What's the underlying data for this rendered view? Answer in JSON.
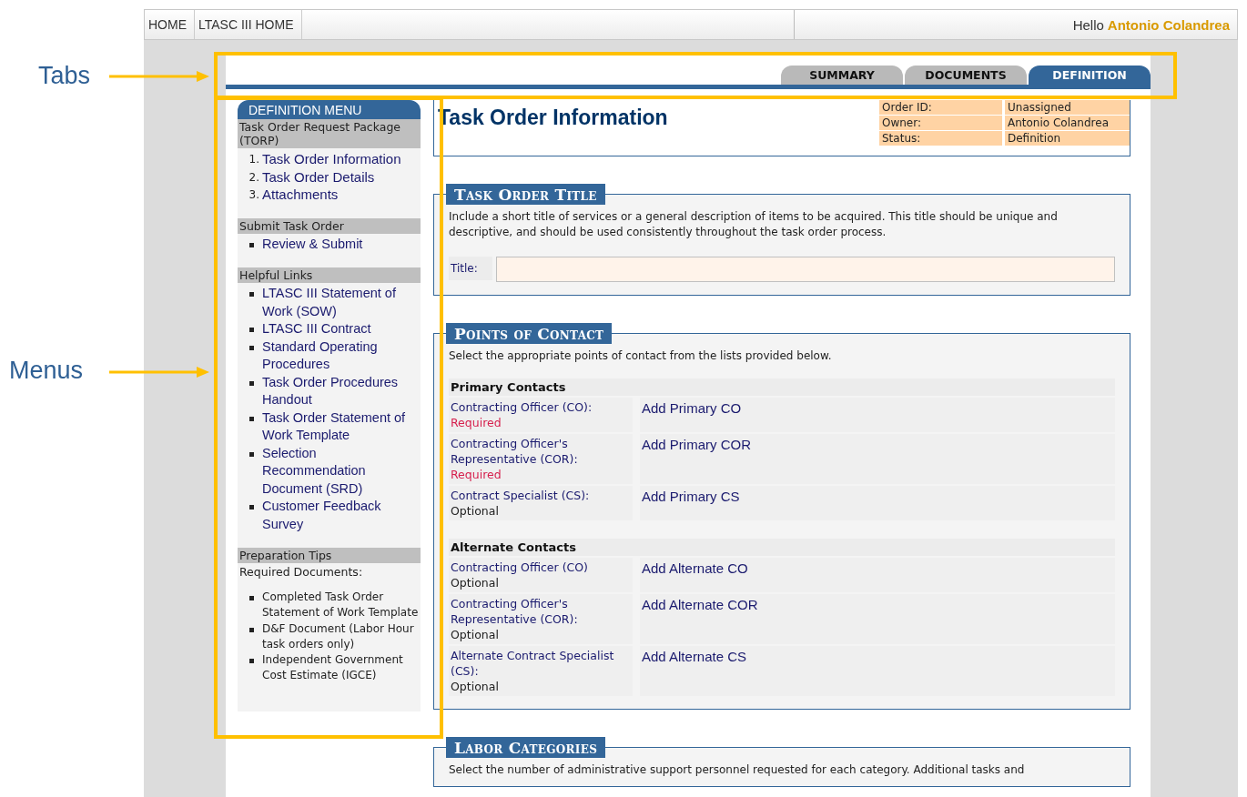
{
  "nav": {
    "links": [
      "HOME",
      "LTASC III HOME"
    ],
    "greeting": "Hello",
    "user": "Antonio Colandrea"
  },
  "tabs": [
    {
      "label": "SUMMARY",
      "selected": false
    },
    {
      "label": "DOCUMENTS",
      "selected": false
    },
    {
      "label": "DEFINITION",
      "selected": true
    }
  ],
  "sidebar": {
    "title": "DEFINITION MENU",
    "sections": [
      {
        "heading": "Task Order Request Package (TORP)",
        "kind": "ordered",
        "items": [
          {
            "label": "Task Order Information",
            "marker": "1."
          },
          {
            "label": "Task Order Details",
            "marker": "2."
          },
          {
            "label": "Attachments",
            "marker": "3."
          }
        ]
      },
      {
        "heading": "Submit Task Order",
        "kind": "links",
        "items": [
          {
            "label": "Review & Submit"
          }
        ]
      },
      {
        "heading": "Helpful Links",
        "kind": "links",
        "items": [
          {
            "label": "LTASC III Statement of Work (SOW)"
          },
          {
            "label": "LTASC III Contract"
          },
          {
            "label": "Standard Operating Procedures"
          },
          {
            "label": "Task Order Procedures Handout"
          },
          {
            "label": "Task Order Statement of Work Template"
          },
          {
            "label": "Selection Recommendation Document (SRD)"
          },
          {
            "label": "Customer Feedback Survey"
          }
        ]
      },
      {
        "heading": "Preparation Tips",
        "kind": "tips",
        "intro": "Required Documents:",
        "items": [
          {
            "label": "Completed Task Order Statement of Work Template"
          },
          {
            "label": "D&F Document (Labor Hour task orders only)"
          },
          {
            "label": "Independent Government Cost Estimate (IGCE)"
          }
        ]
      }
    ]
  },
  "page_title": "Task Order Information",
  "order_info": [
    {
      "label": "Order ID:",
      "value": "Unassigned"
    },
    {
      "label": "Owner:",
      "value": "Antonio Colandrea"
    },
    {
      "label": "Status:",
      "value": "Definition"
    }
  ],
  "title_section": {
    "heading": "Task Order Title",
    "description": "Include a short title of services or a general description of items to be acquired. This title should be unique and descriptive, and should be used consistently throughout the task order process.",
    "field_label": "Title:"
  },
  "contacts_section": {
    "heading": "Points of Contact",
    "description": "Select the appropriate points of contact from the lists provided below.",
    "groups": [
      {
        "heading": "Primary Contacts",
        "rows": [
          {
            "role": "Contracting Officer (CO):",
            "note": "Required",
            "kind": "required",
            "action": "Add Primary CO"
          },
          {
            "role": "Contracting Officer's Representative (COR):",
            "note": "Required",
            "kind": "required",
            "action": "Add Primary COR"
          },
          {
            "role": "Contract Specialist (CS):",
            "note": "Optional",
            "kind": "optional",
            "action": "Add Primary CS"
          }
        ]
      },
      {
        "heading": "Alternate Contacts",
        "rows": [
          {
            "role": "Contracting Officer (CO)",
            "note": "Optional",
            "kind": "optional",
            "action": "Add Alternate CO"
          },
          {
            "role": "Contracting Officer's Representative (COR):",
            "note": "Optional",
            "kind": "optional",
            "action": "Add Alternate COR"
          },
          {
            "role": "Alternate Contract Specialist (CS):",
            "note": "Optional",
            "kind": "optional",
            "action": "Add Alternate CS"
          }
        ]
      }
    ]
  },
  "labor_section": {
    "heading": "Labor Categories",
    "description": "Select the number of administrative support personnel requested for each category. Additional tasks and"
  },
  "annotations": [
    {
      "label": "Tabs",
      "kind": "tabs"
    },
    {
      "label": "Menus",
      "kind": "menus"
    }
  ]
}
